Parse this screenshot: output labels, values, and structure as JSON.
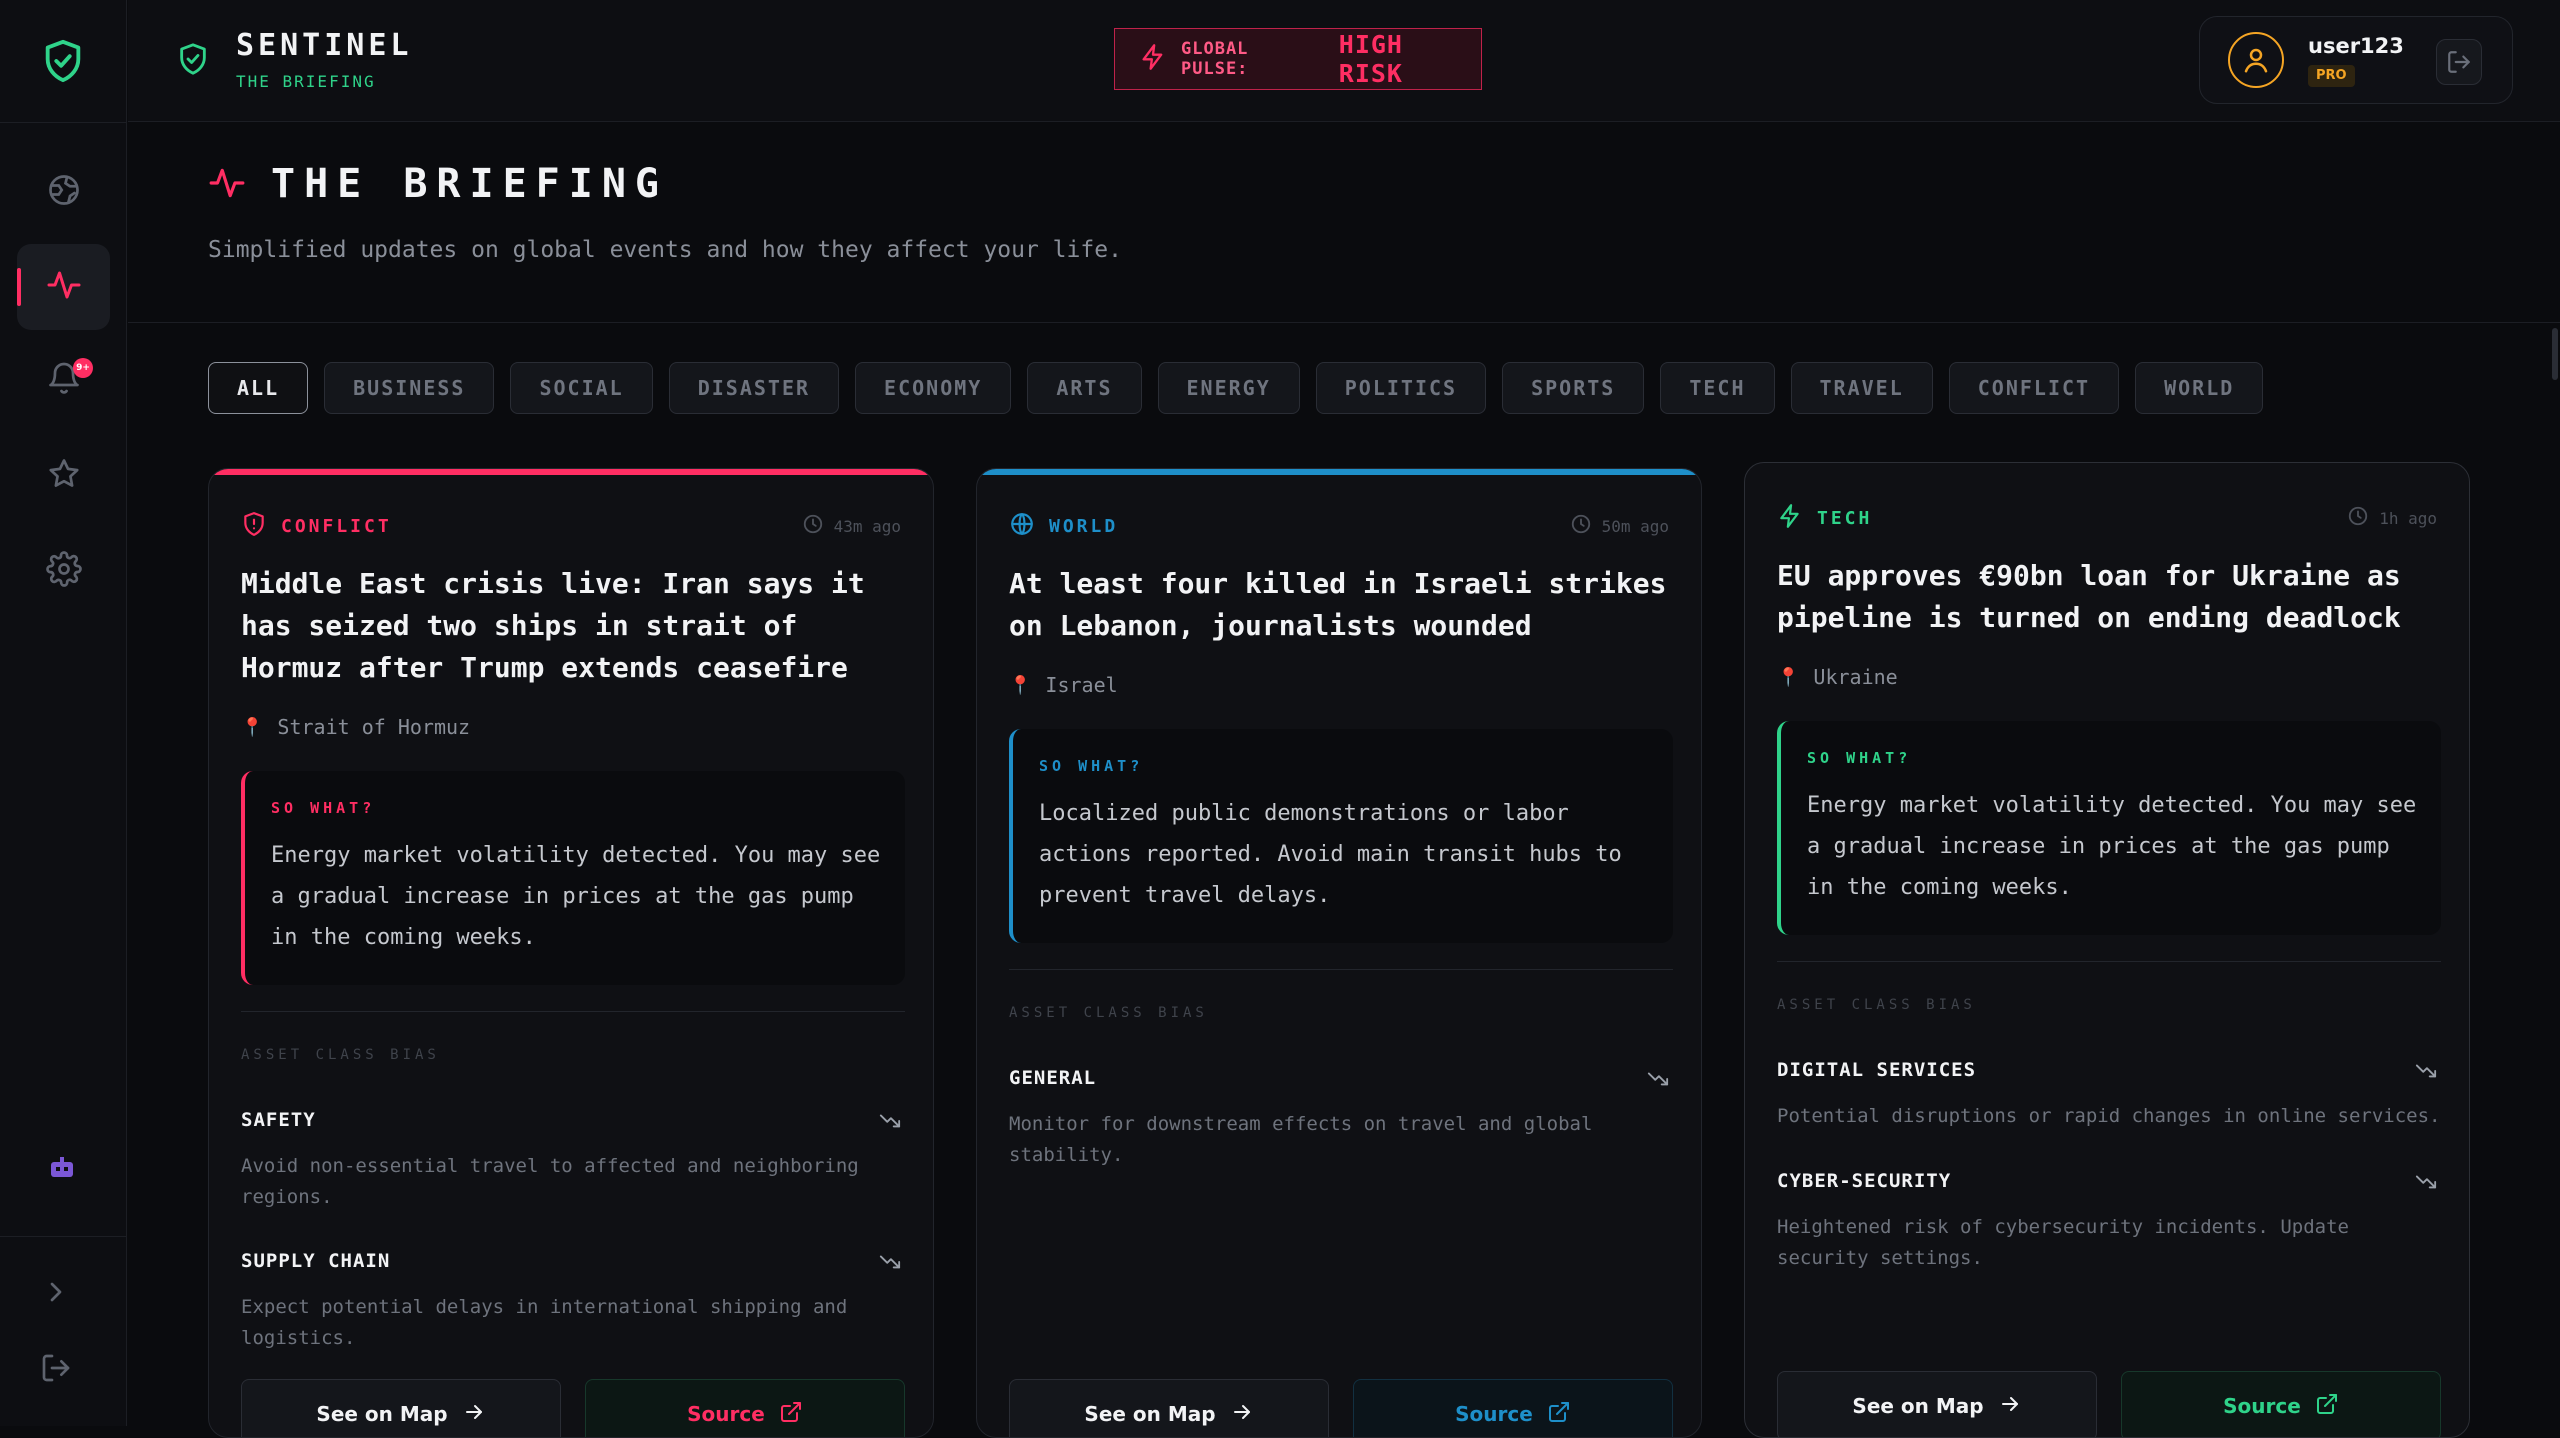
{
  "app": {
    "name": "SENTINEL",
    "subtitle": "THE BRIEFING"
  },
  "pulse": {
    "label": "GLOBAL PULSE:",
    "value": "HIGH RISK"
  },
  "user": {
    "name": "user123",
    "tier": "PRO"
  },
  "rail": {
    "notification_count": "9+"
  },
  "hero": {
    "title": "THE BRIEFING",
    "subtitle": "Simplified updates on global events and how they affect your life."
  },
  "filters": [
    "ALL",
    "BUSINESS",
    "SOCIAL",
    "DISASTER",
    "ECONOMY",
    "ARTS",
    "ENERGY",
    "POLITICS",
    "SPORTS",
    "TECH",
    "TRAVEL",
    "CONFLICT",
    "WORLD"
  ],
  "colors": {
    "accent": "#ff2e63",
    "brand": "#2fd38a",
    "world": "#1e8fc9",
    "pro": "#f5a524"
  },
  "cards": [
    {
      "category": "CONFLICT",
      "icon": "shield-alert-icon",
      "color": "#ff2e63",
      "time": "43m ago",
      "title": "Middle East crisis live: Iran says it has seized two ships in strait of Hormuz after Trump extends ceasefire",
      "location": "Strait of Hormuz",
      "so_what_label": "SO WHAT?",
      "so_what": "Energy market volatility detected. You may see a gradual increase in prices at the gas pump in the coming weeks.",
      "asset_label": "ASSET CLASS BIAS",
      "assets": [
        {
          "name": "SAFETY",
          "trend": "down",
          "desc": "Avoid non-essential travel to affected and neighboring regions."
        },
        {
          "name": "SUPPLY CHAIN",
          "trend": "down",
          "desc": "Expect potential delays in international shipping and logistics."
        }
      ],
      "map_label": "See on Map",
      "source_label": "Source"
    },
    {
      "category": "WORLD",
      "icon": "globe-icon",
      "color": "#1e8fc9",
      "time": "50m ago",
      "title": "At least four killed in Israeli strikes on Lebanon, journalists wounded",
      "location": "Israel",
      "so_what_label": "SO WHAT?",
      "so_what": "Localized public demonstrations or labor actions reported. Avoid main transit hubs to prevent travel delays.",
      "asset_label": "ASSET CLASS BIAS",
      "assets": [
        {
          "name": "GENERAL",
          "trend": "down",
          "desc": "Monitor for downstream effects on travel and global stability."
        }
      ],
      "map_label": "See on Map",
      "source_label": "Source"
    },
    {
      "category": "TECH",
      "icon": "lightning-icon",
      "color": "#2fd38a",
      "time": "1h ago",
      "title": "EU approves €90bn loan for Ukraine as pipeline is turned on ending deadlock",
      "location": "Ukraine",
      "so_what_label": "SO WHAT?",
      "so_what": "Energy market volatility detected. You may see a gradual increase in prices at the gas pump in the coming weeks.",
      "asset_label": "ASSET CLASS BIAS",
      "assets": [
        {
          "name": "DIGITAL SERVICES",
          "trend": "down",
          "desc": "Potential disruptions or rapid changes in online services."
        },
        {
          "name": "CYBER-SECURITY",
          "trend": "down",
          "desc": "Heightened risk of cybersecurity incidents. Update security settings."
        }
      ],
      "map_label": "See on Map",
      "source_label": "Source"
    }
  ]
}
